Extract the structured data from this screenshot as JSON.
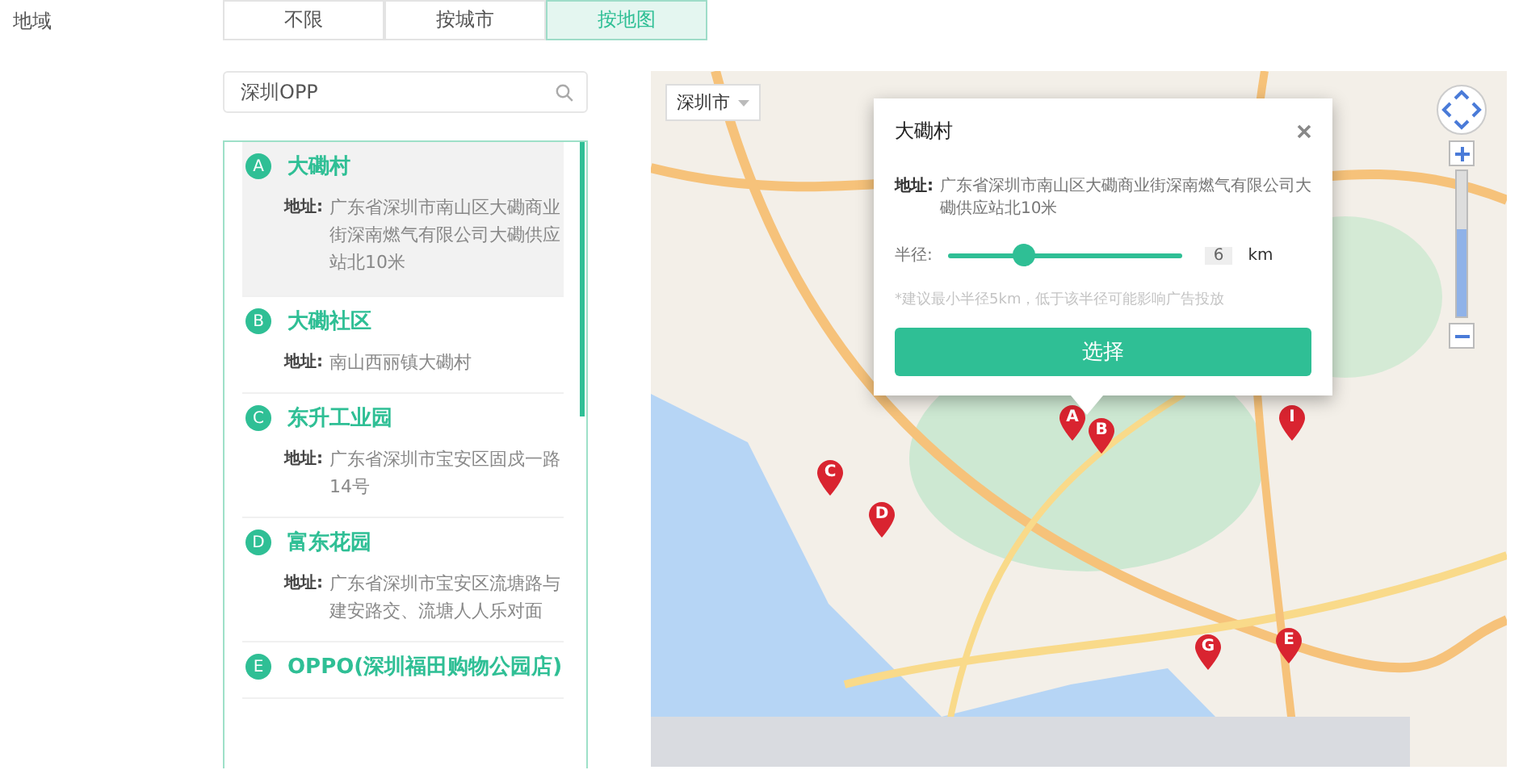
{
  "region": {
    "label": "地域",
    "tabs": [
      {
        "label": "不限",
        "selected": false
      },
      {
        "label": "按城市",
        "selected": false
      },
      {
        "label": "按地图",
        "selected": true
      }
    ]
  },
  "search": {
    "value": "深圳OPP"
  },
  "results": [
    {
      "letter": "A",
      "name": "大磡村",
      "address_label": "地址:",
      "address": "广东省深圳市南山区大磡商业街深南燃气有限公司大磡供应站北10米",
      "selected": true
    },
    {
      "letter": "B",
      "name": "大磡社区",
      "address_label": "地址:",
      "address": "南山西丽镇大磡村",
      "selected": false
    },
    {
      "letter": "C",
      "name": "东升工业园",
      "address_label": "地址:",
      "address": "广东省深圳市宝安区固戍一路14号",
      "selected": false
    },
    {
      "letter": "D",
      "name": "富东花园",
      "address_label": "地址:",
      "address": "广东省深圳市宝安区流塘路与建安路交、流塘人人乐对面",
      "selected": false
    },
    {
      "letter": "E",
      "name": "OPPO(深圳福田购物公园店)",
      "selected": false
    }
  ],
  "map": {
    "city": "深圳市",
    "pins": [
      "A",
      "B",
      "C",
      "D",
      "E",
      "G",
      "I"
    ],
    "zoom": {
      "level": 0.6
    },
    "popup": {
      "title": "大磡村",
      "address_label": "地址:",
      "address": "广东省深圳市南山区大磡商业街深南燃气有限公司大磡供应站北10米",
      "radius_label": "半径:",
      "radius": {
        "level": 0.32,
        "value": "6",
        "unit": "km"
      },
      "hint": "*建议最小半径5km，低于该半径可能影响广告投放",
      "button": "选择"
    }
  }
}
